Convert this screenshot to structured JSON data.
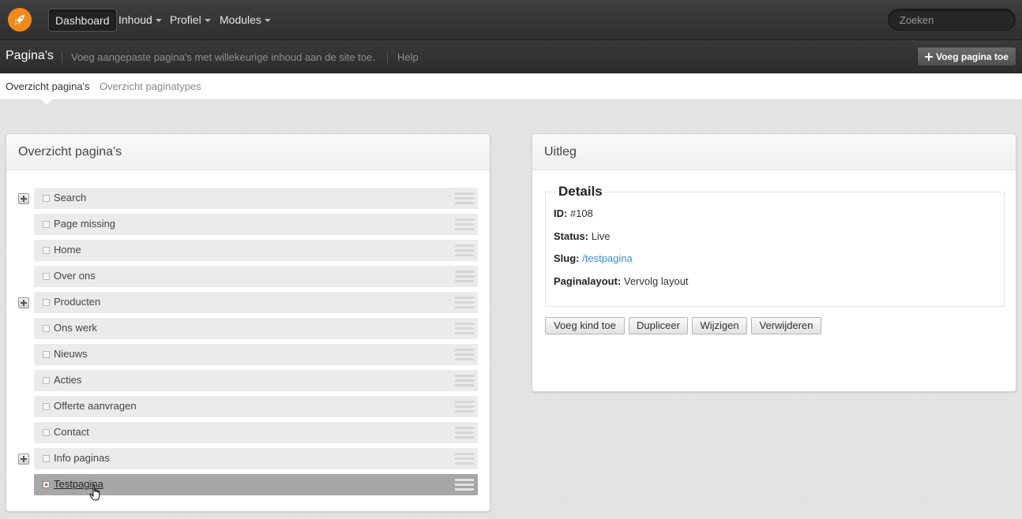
{
  "topnav": {
    "items": [
      {
        "label": "Dashboard",
        "active": true
      },
      {
        "label": "Inhoud",
        "dropdown": true
      },
      {
        "label": "Profiel",
        "dropdown": true
      },
      {
        "label": "Modules",
        "dropdown": true
      }
    ],
    "search_placeholder": "Zoeken",
    "logo_icon": "rocket-icon",
    "accent": "#f08a1c"
  },
  "subheader": {
    "title": "Pagina's",
    "description": "Voeg aangepaste pagina's met willekeurige inhoud aan de site toe.",
    "help": "Help",
    "add_button": "Voeg pagina toe",
    "add_icon": "plus-icon"
  },
  "tabs": [
    {
      "label": "Overzicht pagina's",
      "active": true
    },
    {
      "label": "Overzicht paginatypes",
      "active": false
    }
  ],
  "tree_panel": {
    "title": "Overzicht pagina's",
    "items": [
      {
        "label": "Search",
        "expandable": true
      },
      {
        "label": "Page missing",
        "expandable": false
      },
      {
        "label": "Home",
        "expandable": false
      },
      {
        "label": "Over ons",
        "expandable": false
      },
      {
        "label": "Producten",
        "expandable": true
      },
      {
        "label": "Ons werk",
        "expandable": false
      },
      {
        "label": "Nieuws",
        "expandable": false
      },
      {
        "label": "Acties",
        "expandable": false
      },
      {
        "label": "Offerte aanvragen",
        "expandable": false
      },
      {
        "label": "Contact",
        "expandable": false
      },
      {
        "label": "Info paginas",
        "expandable": true
      },
      {
        "label": "Testpagina",
        "expandable": false,
        "selected": true
      }
    ]
  },
  "info_panel": {
    "title": "Uitleg",
    "details_legend": "Details",
    "id_label": "ID:",
    "id_value": "#108",
    "status_label": "Status:",
    "status_value": "Live",
    "slug_label": "Slug:",
    "slug_value": "/testpagina",
    "layout_label": "Paginalayout:",
    "layout_value": "Vervolg layout",
    "buttons": [
      "Voeg kind toe",
      "Dupliceer",
      "Wijzigen",
      "Verwijderen"
    ],
    "link_color": "#3a8fd6"
  }
}
